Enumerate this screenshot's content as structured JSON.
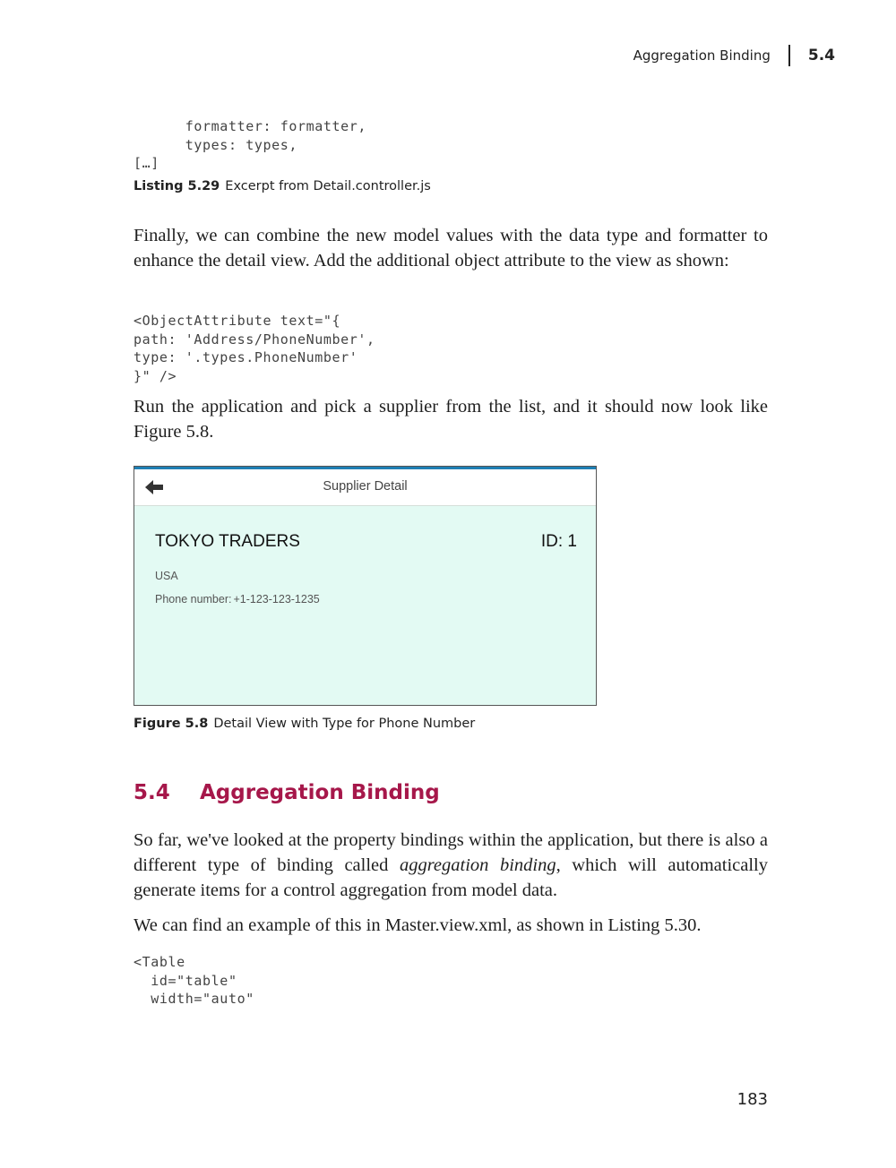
{
  "running_head": {
    "title": "Aggregation Binding",
    "section_number": "5.4"
  },
  "listing_5_29": {
    "code_lines": [
      "      formatter: formatter,",
      "      types: types,",
      "[…]"
    ],
    "caption_label": "Listing 5.29",
    "caption_text": "Excerpt from Detail.controller.js"
  },
  "paragraph_1": "Finally, we can combine the new model values with the data type and formatter to enhance the detail view. Add the additional object attribute to the view as shown:",
  "code_object_attribute": [
    "<ObjectAttribute text=\"{",
    "path: 'Address/PhoneNumber',",
    "type: '.types.PhoneNumber'",
    "}\" />"
  ],
  "paragraph_2": "Run the application and pick a supplier from the list, and it should now look like Figure 5.8.",
  "figure_5_8": {
    "header_title": "Supplier Detail",
    "back_icon": "arrow-left-icon",
    "object_title": "TOKYO TRADERS",
    "object_number": "ID: 1",
    "country": "USA",
    "phone_label": "Phone number:",
    "phone_value": "+1-123-123-1235",
    "colors": {
      "accent": "#1f7fb4",
      "content_background": "#e3faf3"
    },
    "caption_label": "Figure 5.8",
    "caption_text": "Detail View with Type for Phone Number"
  },
  "section": {
    "number": "5.4",
    "title": "Aggregation Binding",
    "color": "#a6174a"
  },
  "paragraph_3": {
    "before_italic": "So far, we've looked at the property bindings within the application, but there is also a different type of binding called ",
    "italic": "aggregation binding",
    "after_italic": ", which will automatically generate items for a control aggregation from model data."
  },
  "paragraph_4": "We can find an example of this in Master.view.xml, as shown in Listing 5.30.",
  "code_table": [
    "<Table",
    "  id=\"table\"",
    "  width=\"auto\""
  ],
  "page_number": "183"
}
